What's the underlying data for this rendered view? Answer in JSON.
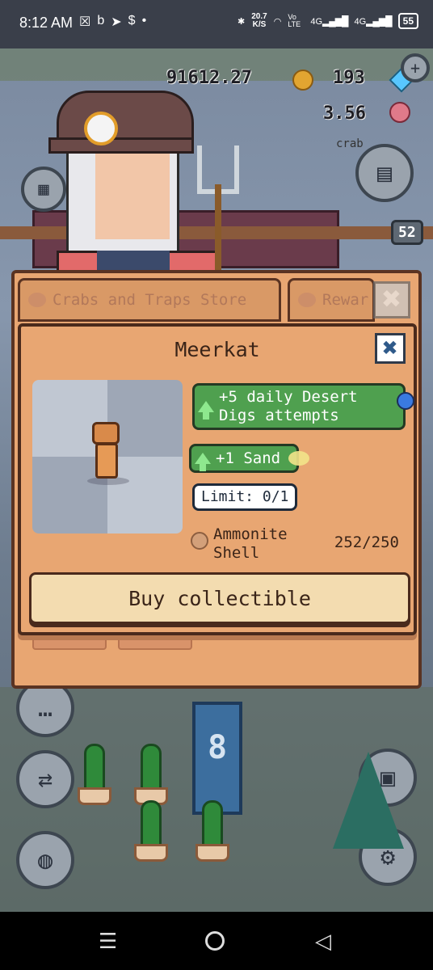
{
  "status_bar": {
    "time": "8:12 AM",
    "left_icons": [
      "☒",
      "b",
      "➤",
      "$",
      "•"
    ],
    "speed_value": "20.7",
    "speed_unit": "K/S",
    "network_1": "Vo LTE",
    "network_2": "4G",
    "network_3": "4G",
    "battery": "55"
  },
  "hud": {
    "coins": "91612.27",
    "gems": "193",
    "secondary_value": "3.56",
    "crab_label": "crab",
    "badge_count": "52"
  },
  "store": {
    "tabs": [
      {
        "label": "Crabs and Traps Store",
        "active": false
      },
      {
        "label": "Rewar",
        "active": false
      }
    ],
    "close_symbol": "✖"
  },
  "item_modal": {
    "title": "Meerkat",
    "close_symbol": "✖",
    "bonuses": [
      {
        "text": "+5 daily Desert Digs attempts",
        "icon": "shovel-icon",
        "color": "#4fa04f"
      },
      {
        "text": "+1 Sand",
        "icon": "sand-icon",
        "color": "#4fa04f"
      }
    ],
    "limit": "Limit: 0/1",
    "cost": {
      "item_name": "Ammonite Shell",
      "count": "252/250",
      "icon": "ammonite-shell-icon"
    },
    "buy_label": "Buy collectible"
  },
  "side_buttons": {
    "left": [
      "calendar-icon",
      "chat-icon",
      "trade-icon",
      "globe-icon"
    ],
    "right": [
      "chest-icon",
      "save-icon",
      "settings-icon"
    ]
  },
  "banner_symbol": "8",
  "navbar": {
    "menu_symbol": "☰",
    "back_symbol": "◁"
  }
}
